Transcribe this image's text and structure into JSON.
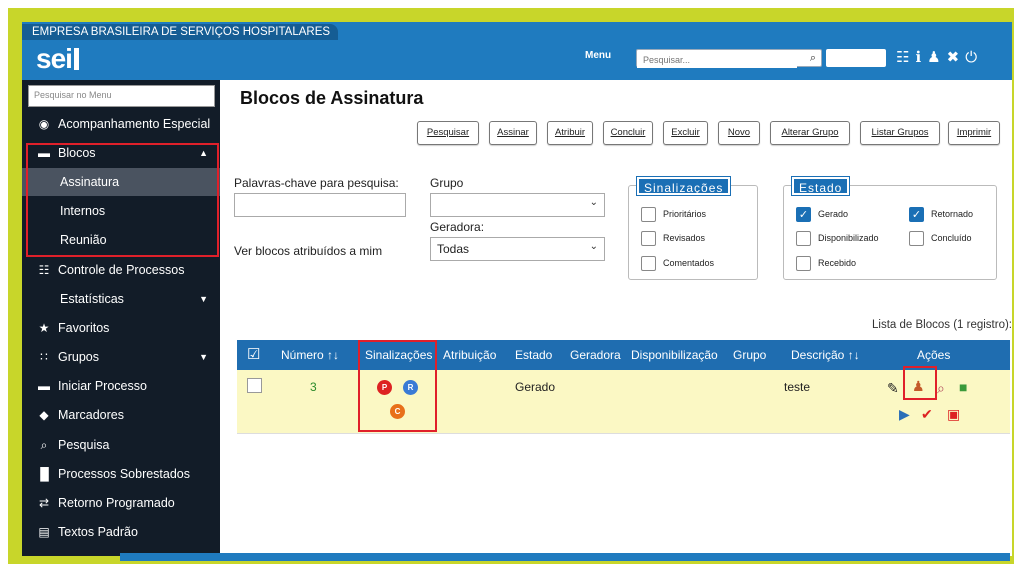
{
  "header": {
    "org_name": "EMPRESA BRASILEIRA DE SERVIÇOS HOSPITALARES",
    "logo": "sei",
    "menu_label": "Menu",
    "search_placeholder": "Pesquisar...",
    "icons": [
      "list-icon",
      "info-icon",
      "user-icon",
      "tools-icon",
      "power-icon"
    ]
  },
  "sidebar": {
    "search_placeholder": "Pesquisar no Menu",
    "items": [
      {
        "label": "Acompanhamento Especial",
        "icon": "eye-icon"
      },
      {
        "label": "Blocos",
        "icon": "book-icon",
        "expanded": true
      },
      {
        "label": "Assinatura",
        "active": true
      },
      {
        "label": "Internos"
      },
      {
        "label": "Reunião"
      },
      {
        "label": "Controle de Processos",
        "icon": "list-icon"
      },
      {
        "label": "Estatísticas"
      },
      {
        "label": "Favoritos",
        "icon": "star-icon"
      },
      {
        "label": "Grupos",
        "icon": "group-icon"
      },
      {
        "label": "Iniciar Processo",
        "icon": "folder-icon"
      },
      {
        "label": "Marcadores",
        "icon": "tag-icon"
      },
      {
        "label": "Pesquisa",
        "icon": "search-icon"
      },
      {
        "label": "Processos Sobrestados",
        "icon": "pause-icon"
      },
      {
        "label": "Retorno Programado",
        "icon": "arrows-icon"
      },
      {
        "label": "Textos Padrão",
        "icon": "document-icon"
      }
    ]
  },
  "main": {
    "title": "Blocos de Assinatura",
    "toolbar": [
      "Pesquisar",
      "Assinar",
      "Atribuir",
      "Concluir",
      "Excluir",
      "Novo",
      "Alterar Grupo",
      "Listar Grupos",
      "Imprimir"
    ],
    "filters": {
      "keywords_label": "Palavras-chave para pesquisa:",
      "keywords_value": "",
      "grupo_label": "Grupo",
      "grupo_value": "",
      "geradora_label": "Geradora:",
      "geradora_value": "Todas",
      "assigned_label": "Ver blocos atribuídos a mim"
    },
    "sinalizacoes": {
      "legend": "Sinalizações",
      "options": [
        {
          "label": "Prioritários",
          "checked": false
        },
        {
          "label": "Revisados",
          "checked": false
        },
        {
          "label": "Comentados",
          "checked": false
        }
      ]
    },
    "estado": {
      "legend": "Estado",
      "options": [
        {
          "label": "Gerado",
          "checked": true
        },
        {
          "label": "Retornado",
          "checked": true
        },
        {
          "label": "Disponibilizado",
          "checked": false
        },
        {
          "label": "Concluído",
          "checked": false
        },
        {
          "label": "Recebido",
          "checked": false
        }
      ]
    },
    "table": {
      "caption": "Lista de Blocos (1 registro):",
      "columns": [
        "Número",
        "Sinalizações",
        "Atribuição",
        "Estado",
        "Geradora",
        "Disponibilização",
        "Grupo",
        "Descrição",
        "Ações"
      ],
      "rows": [
        {
          "numero": "3",
          "badges": [
            "P",
            "R",
            "C"
          ],
          "atribuicao": "",
          "estado": "Gerado",
          "geradora": "",
          "disponibilizacao": "",
          "grupo": "",
          "descricao": "teste"
        }
      ]
    }
  },
  "colors": {
    "topbar": "#1f7bbf",
    "sidebar": "#121c28",
    "table_header": "#1f6db0",
    "row_highlight": "#fbf8c4",
    "annotation_red": "#e0202a",
    "frame_yellow": "#c8d62a"
  }
}
